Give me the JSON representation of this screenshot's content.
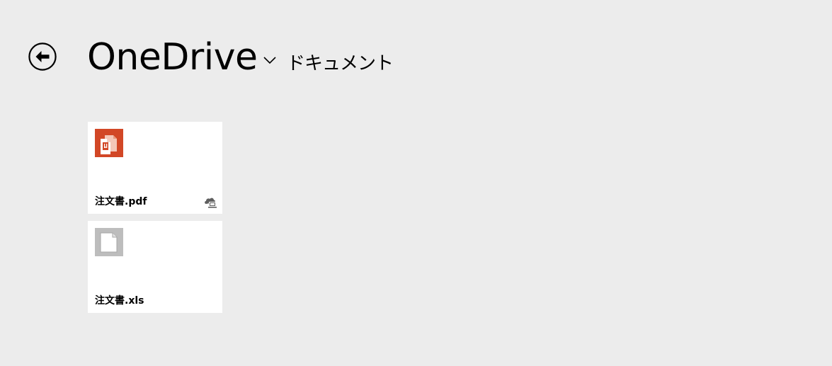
{
  "header": {
    "title": "OneDrive",
    "location": "ドキュメント",
    "back_icon": "back-arrow-circle-icon",
    "chevron_icon": "chevron-down-icon"
  },
  "files": [
    {
      "name": "注文書.pdf",
      "icon": "pdf-file-icon",
      "icon_color": "#d24726",
      "status_icon": "cloud-offline-available-icon"
    },
    {
      "name": "注文書.xls",
      "icon": "generic-file-icon",
      "icon_color": "#bdbdbd"
    }
  ],
  "colors": {
    "background": "#ececec",
    "tile": "#ffffff",
    "text": "#000000",
    "status_icon": "#5f5f5f"
  }
}
